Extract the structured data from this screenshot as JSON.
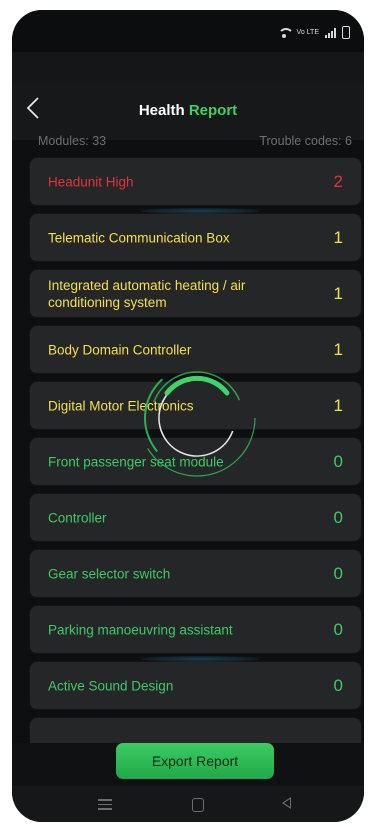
{
  "status_bar": {
    "network_label": "Vo LTE"
  },
  "header": {
    "title_main": "Health",
    "title_accent": "Report"
  },
  "summary": {
    "modules": "Modules: 33",
    "trouble_codes": "Trouble codes: 6"
  },
  "modules": [
    {
      "label": "Headunit High",
      "count": "2",
      "color": "#e0353a"
    },
    {
      "label": "Telematic Communication Box",
      "count": "1",
      "color": "#f4e04a"
    },
    {
      "label": "Integrated automatic heating / air conditioning system",
      "count": "1",
      "color": "#f4e04a"
    },
    {
      "label": "Body Domain Controller",
      "count": "1",
      "color": "#f4e04a"
    },
    {
      "label": "Digital Motor Electronics",
      "count": "1",
      "color": "#f4e04a"
    },
    {
      "label": "Front passenger seat module",
      "count": "0",
      "color": "#3fca66"
    },
    {
      "label": "Controller",
      "count": "0",
      "color": "#3fca66"
    },
    {
      "label": "Gear selector switch",
      "count": "0",
      "color": "#3fca66"
    },
    {
      "label": "Parking manoeuvring assistant",
      "count": "0",
      "color": "#3fca66"
    },
    {
      "label": "Active Sound Design",
      "count": "0",
      "color": "#3fca66"
    }
  ],
  "export_button": {
    "label": "Export Report"
  },
  "colors": {
    "accent_green": "#3ed163",
    "error_red": "#e0353a",
    "warning_yellow": "#f4e04a",
    "ok_green": "#3fca66"
  }
}
